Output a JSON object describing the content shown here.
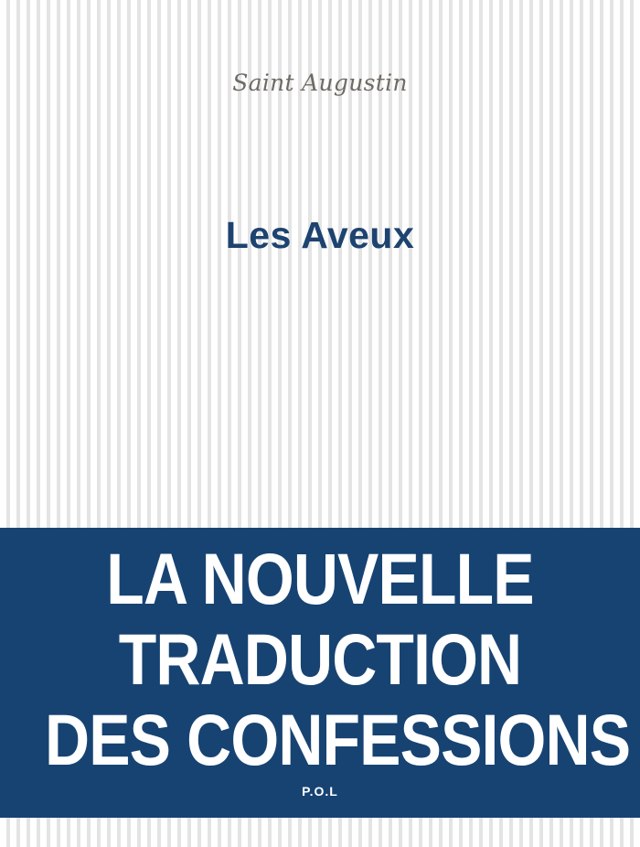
{
  "cover": {
    "author": "Saint Augustin",
    "title": "Les Aveux",
    "banner_lines": [
      "LA NOUVELLE",
      "TRADUCTION",
      "DES CONFESSIONS"
    ],
    "publisher": "P.O.L"
  },
  "colors": {
    "background": "#ffffff",
    "stripe": "#e4e4e4",
    "author_text": "#6f6a64",
    "title_text": "#1d4370",
    "banner_background": "#174372",
    "banner_text": "#ffffff"
  }
}
